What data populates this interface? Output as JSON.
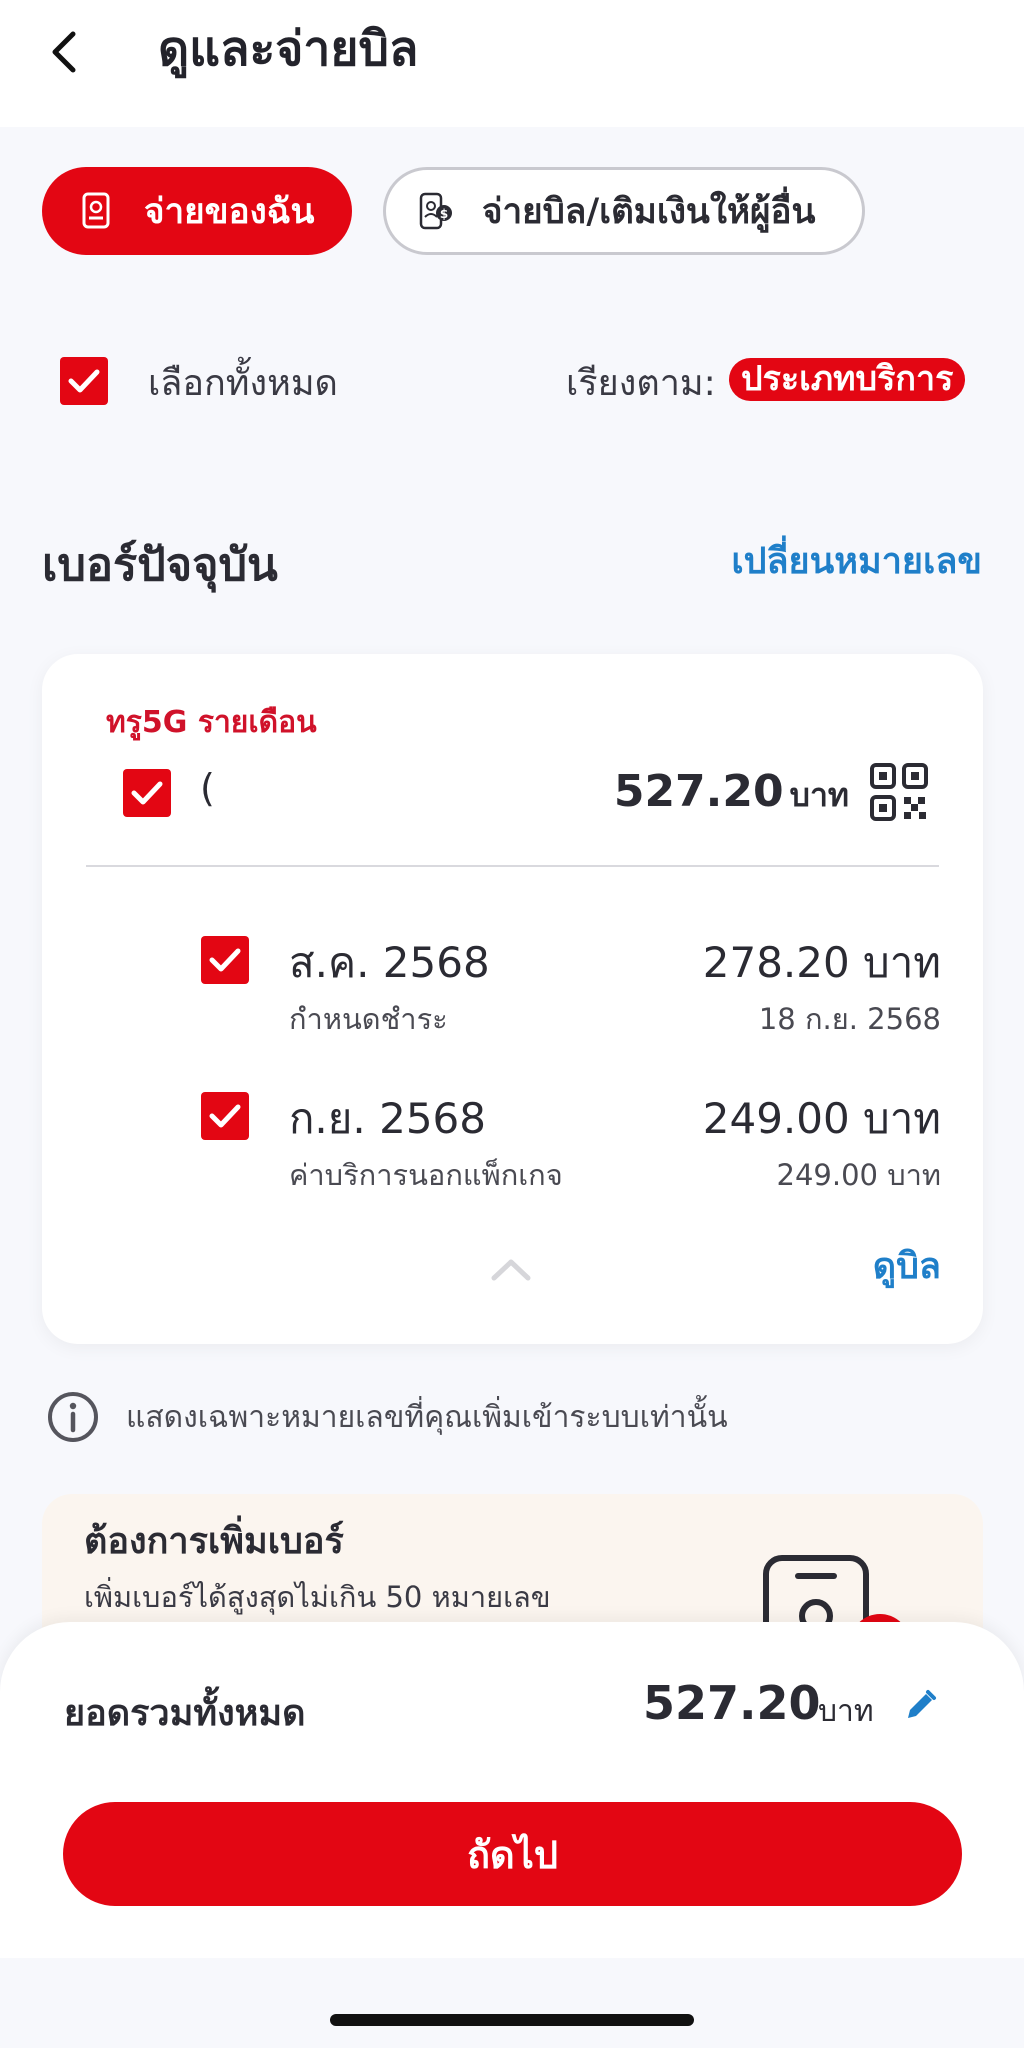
{
  "header": {
    "title": "ดูและจ่ายบิล",
    "back_icon": "chevron-left-icon"
  },
  "tabs": [
    {
      "label": "จ่ายของฉัน",
      "icon": "bill-icon",
      "active": true
    },
    {
      "label": "จ่ายบิล/เติมเงินให้ผู้อื่น",
      "icon": "phone-transfer-icon",
      "active": false
    }
  ],
  "selection": {
    "select_all_label": "เลือกทั้งหมด",
    "checked": true
  },
  "sort": {
    "label": "เรียงตาม:",
    "value": "ประเภทบริการ"
  },
  "section": {
    "title": "เบอร์ปัจจุบัน",
    "change_link": "เปลี่ยนหมายเลข"
  },
  "account": {
    "plan": "ทรู5G รายเดือน",
    "number": "(",
    "total": "527.20",
    "unit": "บาท",
    "bills": [
      {
        "month": "ส.ค. 2568",
        "sub_label": "กำหนดชำระ",
        "amount": "278.20 บาท",
        "sub_value": "18 ก.ย. 2568",
        "checked": true
      },
      {
        "month": "ก.ย. 2568",
        "sub_label": "ค่าบริการนอกแพ็กเกจ",
        "amount": "249.00 บาท",
        "sub_value": "249.00 บาท",
        "checked": true
      }
    ],
    "view_bill": "ดูบิล"
  },
  "info": {
    "text": "แสดงเฉพาะหมายเลขที่คุณเพิ่มเข้าระบบเท่านั้น"
  },
  "promo": {
    "title": "ต้องการเพิ่มเบอร์",
    "subtitle": "เพิ่มเบอร์ได้สูงสุดไม่เกิน 50 หมายเลข"
  },
  "summary": {
    "label": "ยอดรวมทั้งหมด",
    "amount": "527.20",
    "unit": "บาท"
  },
  "next_button": {
    "label": "ถัดไป"
  },
  "colors": {
    "accent": "#e30613",
    "link": "#1f7fc9",
    "plan_text": "#d0122a"
  }
}
